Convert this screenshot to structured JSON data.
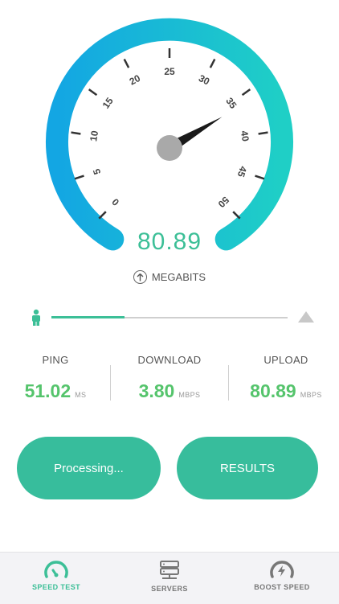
{
  "gauge": {
    "ticks": [
      "0",
      "5",
      "10",
      "15",
      "20",
      "25",
      "30",
      "35",
      "40",
      "45",
      "50"
    ],
    "needle_value": 36,
    "value": "80.89",
    "unit_label": "MEGABITS",
    "colors": {
      "arc_start": "#13a6e3",
      "arc_end": "#1fcfc6",
      "needle": "#1a1a1a",
      "hub": "#a9a9a9"
    }
  },
  "progress": {
    "fraction": 0.31,
    "color": "#3cbf97"
  },
  "stats": {
    "ping": {
      "label": "PING",
      "value": "51.02",
      "unit": "MS"
    },
    "download": {
      "label": "DOWNLOAD",
      "value": "3.80",
      "unit": "MBPS"
    },
    "upload": {
      "label": "UPLOAD",
      "value": "80.89",
      "unit": "MBPS"
    }
  },
  "buttons": {
    "processing": "Processing...",
    "results": "RESULTS"
  },
  "tabs": [
    {
      "label": "SPEED TEST",
      "icon": "speedometer-icon",
      "active": true
    },
    {
      "label": "SERVERS",
      "icon": "server-icon",
      "active": false
    },
    {
      "label": "BOOST SPEED",
      "icon": "boost-gauge-icon",
      "active": false
    }
  ],
  "accent_color": "#37bd9c"
}
